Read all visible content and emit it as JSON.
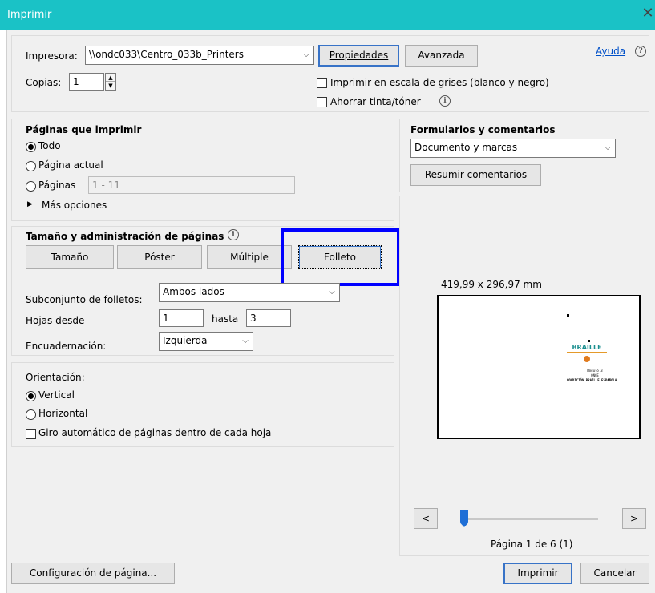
{
  "window": {
    "title": "Imprimir",
    "close_glyph": "✕"
  },
  "printer": {
    "label": "Impresora:",
    "value": "\\\\ondc033\\Centro_033b_Printers",
    "properties_label": "Propiedades",
    "advanced_label": "Avanzada",
    "help_label": "Ayuda"
  },
  "copies": {
    "label": "Copias:",
    "value": "1"
  },
  "options": {
    "grayscale_label": "Imprimir en escala de grises (blanco y negro)",
    "grayscale_checked": false,
    "save_ink_label": "Ahorrar tinta/tóner",
    "save_ink_checked": false
  },
  "pages": {
    "title": "Páginas que imprimir",
    "all_label": "Todo",
    "current_label": "Página actual",
    "range_label": "Páginas",
    "range_placeholder": "1 - 11",
    "more_label": "Más opciones",
    "selected": "all"
  },
  "forms": {
    "title": "Formularios y comentarios",
    "value": "Documento y marcas",
    "summarize_label": "Resumir comentarios"
  },
  "sizing": {
    "title": "Tamaño y administración de páginas",
    "buttons": [
      "Tamaño",
      "Póster",
      "Múltiple",
      "Folleto"
    ],
    "selected": "Folleto",
    "subset_label": "Subconjunto de folletos:",
    "subset_value": "Ambos lados",
    "sheets_from_label": "Hojas desde",
    "sheets_from_value": "1",
    "sheets_to_label": "hasta",
    "sheets_to_value": "3",
    "binding_label": "Encuadernación:",
    "binding_value": "Izquierda"
  },
  "orientation": {
    "title": "Orientación:",
    "portrait_label": "Vertical",
    "landscape_label": "Horizontal",
    "selected": "portrait",
    "auto_rotate_label": "Giro automático de páginas dentro de cada hoja",
    "auto_rotate_checked": false
  },
  "preview": {
    "dimensions": "419,99 x 296,97 mm",
    "logo_text": "BRAILLE",
    "line1": "Módulo 3",
    "line2": "ONCE",
    "line3": "CONDICIÓN BRAILLE ESPAÑOLA",
    "page_status": "Página 1 de 6 (1)",
    "prev_glyph": "<",
    "next_glyph": ">",
    "slider_fraction": 0.0
  },
  "footer": {
    "page_setup_label": "Configuración de página...",
    "print_label": "Imprimir",
    "cancel_label": "Cancelar"
  },
  "colors": {
    "titlebar": "#1ac2c6",
    "highlight": "#0000ff",
    "slider_thumb": "#1f6fd6"
  }
}
